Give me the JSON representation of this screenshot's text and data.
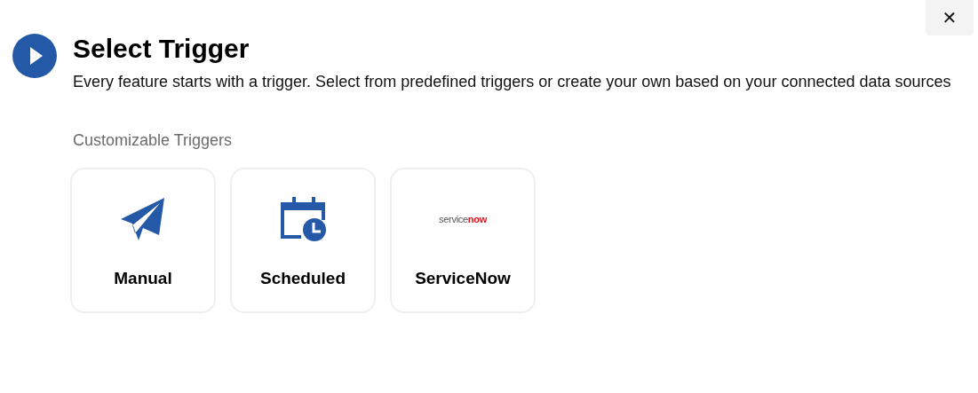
{
  "close_button": {
    "label": "✕"
  },
  "header": {
    "title": "Select Trigger",
    "description": "Every feature starts with a trigger. Select from predefined triggers or create your own based on your connected data sources"
  },
  "section": {
    "heading": "Customizable Triggers"
  },
  "triggers": [
    {
      "kind": "manual",
      "label": "Manual"
    },
    {
      "kind": "scheduled",
      "label": "Scheduled"
    },
    {
      "kind": "logo",
      "label": "ServiceNow",
      "logo": {
        "main": "service",
        "accent": "now"
      }
    }
  ]
}
